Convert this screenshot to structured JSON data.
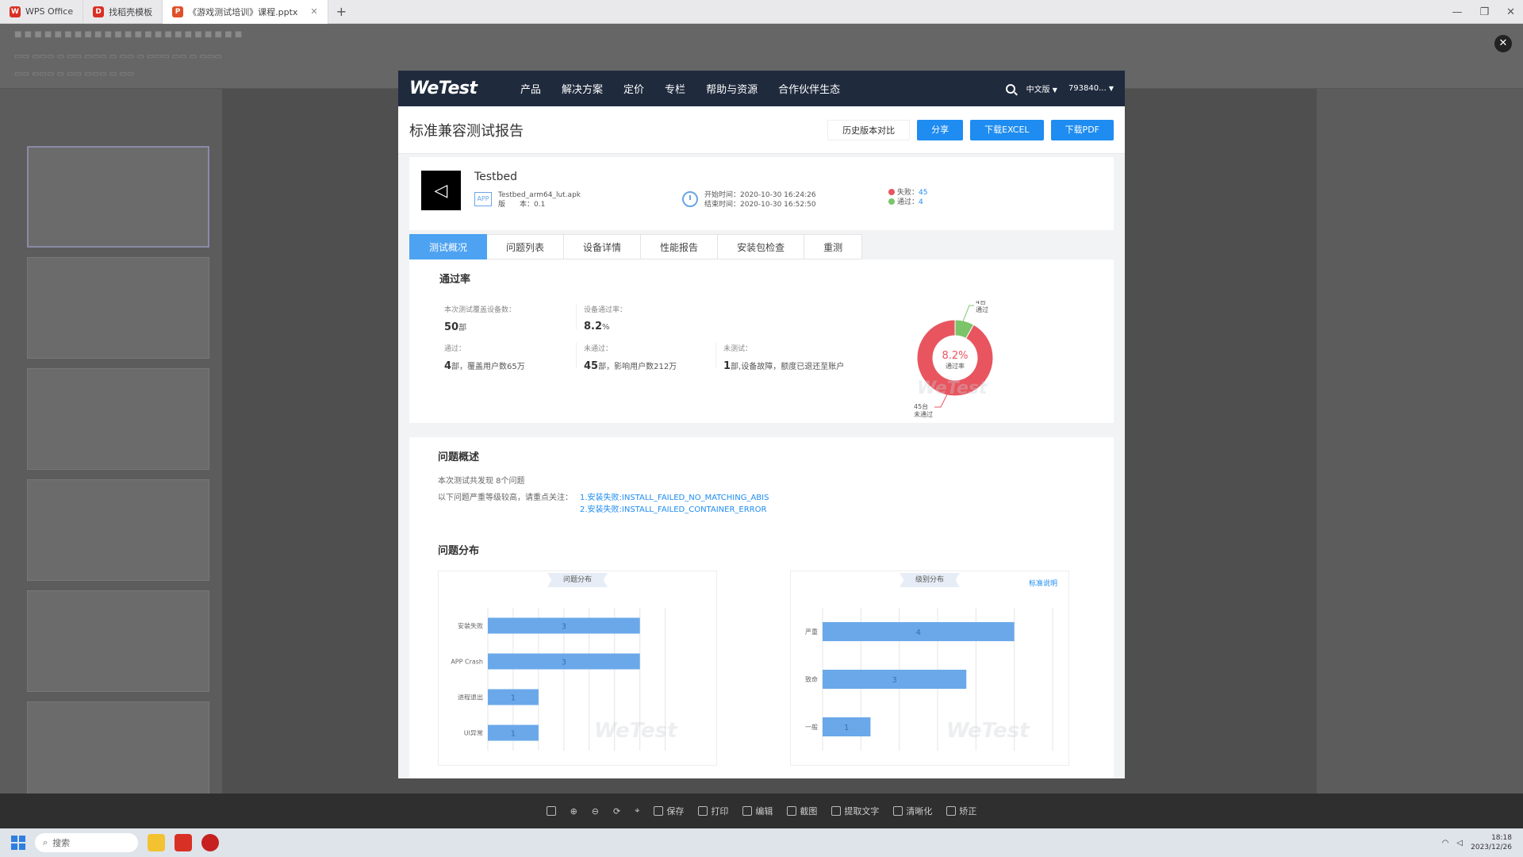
{
  "titlebar": {
    "tabs": [
      {
        "label": "WPS Office",
        "color": "#d93025"
      },
      {
        "label": "找稻壳模板",
        "color": "#d93025"
      },
      {
        "label": "《游戏测试培训》课程.pptx",
        "color": "#e0502a"
      }
    ]
  },
  "wetest": {
    "logo": "WeTest",
    "nav": [
      "产品",
      "解决方案",
      "定价",
      "专栏",
      "帮助与资源",
      "合作伙伴生态"
    ],
    "lang": "中文版",
    "account": "793840..."
  },
  "report": {
    "title": "标准兼容测试报告",
    "buttons": {
      "history": "历史版本对比",
      "share": "分享",
      "excel": "下载EXCEL",
      "pdf": "下载PDF"
    }
  },
  "app": {
    "name": "Testbed",
    "badge": "APP",
    "apk": "Testbed_arm64_lut.apk",
    "version": "版　　本：0.1",
    "start": "开始时间：2020-10-30 16:24:26",
    "end": "结束时间：2020-10-30 16:52:50",
    "fail_label": "失败：",
    "fail_value": "45",
    "pass_label": "通过：",
    "pass_value": "4"
  },
  "tabs": [
    "测试概况",
    "问题列表",
    "设备详情",
    "性能报告",
    "安装包检查",
    "重测"
  ],
  "pass_rate": {
    "title": "通过率",
    "devices_label": "本次测试覆盖设备数：",
    "devices_num": "50",
    "devices_unit": "部",
    "rate_label": "设备通过率：",
    "rate_num": "8.2",
    "rate_unit": "%",
    "passed_label": "通过：",
    "passed_num": "4",
    "passed_text": "部，覆盖用户数65万",
    "failed_label": "未通过：",
    "failed_num": "45",
    "failed_text": "部，影响用户数212万",
    "untested_label": "未测试：",
    "untested_num": "1",
    "untested_text": "部,设备故障，额度已退还至账户",
    "donut_center": "8.2%",
    "donut_sub": "通过率",
    "pass_callout": "4台",
    "pass_callout_sub": "通过",
    "fail_callout": "45台",
    "fail_callout_sub": "未通过"
  },
  "issues": {
    "title": "问题概述",
    "summary": "本次测试共发现 8个问题",
    "focus": "以下问题严重等级较高，请重点关注：",
    "item1": "1.安装失败:INSTALL_FAILED_NO_MATCHING_ABIS",
    "item2": "2.安装失败:INSTALL_FAILED_CONTAINER_ERROR",
    "dist_title": "问题分布",
    "panel1_title": "问题分布",
    "panel2_title": "级别分布",
    "panel2_link": "标准说明",
    "watermark": "WeTest"
  },
  "chart_data": [
    {
      "type": "bar",
      "title": "问题分布",
      "orientation": "horizontal",
      "categories": [
        "安装失败",
        "APP Crash",
        "进程退出",
        "UI异常"
      ],
      "values": [
        3,
        3,
        1,
        1
      ],
      "color": "#6aa8ea"
    },
    {
      "type": "bar",
      "title": "级别分布",
      "orientation": "horizontal",
      "categories": [
        "严重",
        "致命",
        "一般"
      ],
      "values": [
        4,
        3,
        1
      ],
      "color": "#6aa8ea"
    }
  ],
  "donut": {
    "pass": 4,
    "fail": 45,
    "pass_color": "#7cc46a",
    "fail_color": "#e8555f"
  },
  "bottombar": [
    "保存",
    "打印",
    "编辑",
    "截图",
    "提取文字",
    "清晰化",
    "矫正"
  ],
  "taskbar": {
    "search": "搜索",
    "time": "18:18",
    "date": "2023/12/26"
  }
}
